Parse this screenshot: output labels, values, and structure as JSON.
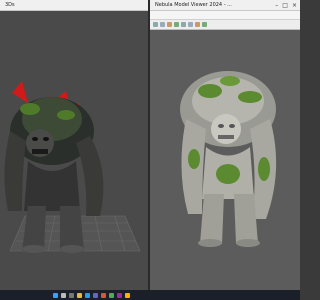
{
  "left_window": {
    "title": "3Ds"
  },
  "right_window": {
    "title": "Nebula Model Viewer 2024 - ..."
  },
  "taskbar": {
    "clock": "",
    "icons": [
      "start-icon",
      "search-icon",
      "taskview-icon",
      "explorer-icon",
      "edge-icon",
      "store-icon",
      "mail-icon",
      "app-icon",
      "app2-icon",
      "app3-icon"
    ]
  },
  "colors": {
    "left_bg": "#4a4a4a",
    "right_bg": "#5c5c5c",
    "accent_red": "#d11a1a",
    "moss_green": "#4f7a2a"
  }
}
